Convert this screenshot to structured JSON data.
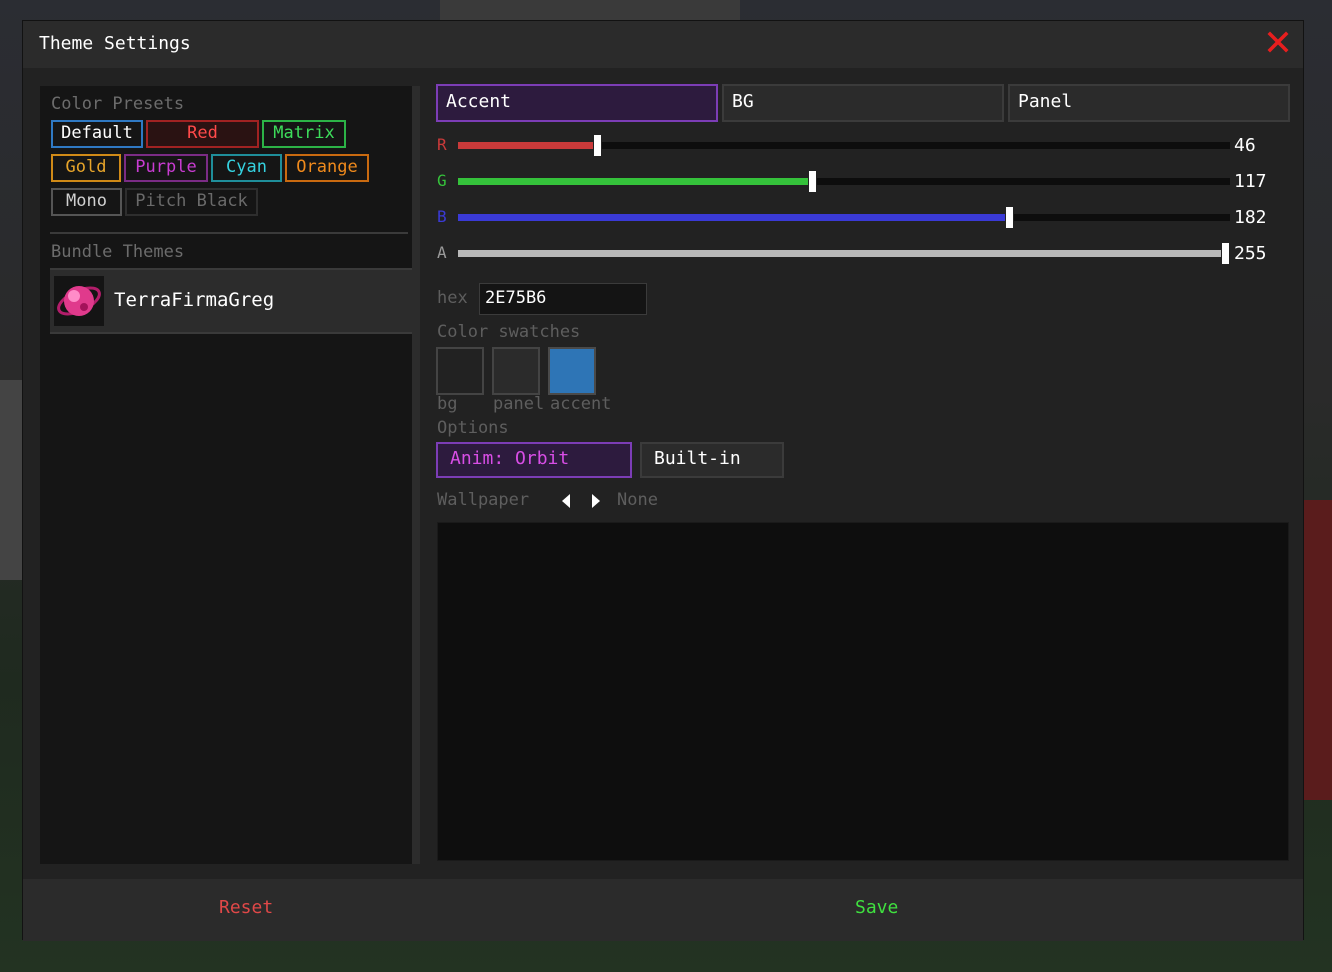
{
  "window": {
    "title": "Theme Settings"
  },
  "presets": {
    "section_label": "Color Presets",
    "items": [
      {
        "label": "Default",
        "text_color": "#ffffff",
        "border_color": "#2f79c3"
      },
      {
        "label": "Red",
        "text_color": "#ff4a4a",
        "border_color": "#a12222"
      },
      {
        "label": "Matrix",
        "text_color": "#3ddc5b",
        "border_color": "#2cb347"
      },
      {
        "label": "Gold",
        "text_color": "#e8a52a",
        "border_color": "#d08a17"
      },
      {
        "label": "Purple",
        "text_color": "#c93cd2",
        "border_color": "#7b2c85"
      },
      {
        "label": "Cyan",
        "text_color": "#35d2e0",
        "border_color": "#1f8e9a"
      },
      {
        "label": "Orange",
        "text_color": "#f08a1c",
        "border_color": "#c96a10"
      },
      {
        "label": "Mono",
        "text_color": "#d0d0d0",
        "border_color": "#555555"
      },
      {
        "label": "Pitch Black",
        "text_color": "#6a6a6a",
        "border_color": "#2e2e2e"
      }
    ]
  },
  "bundle": {
    "section_label": "Bundle Themes",
    "items": [
      {
        "name": "TerraFirmaGreg",
        "icon": "pink-planet-icon"
      }
    ]
  },
  "tabs": [
    {
      "label": "Accent",
      "active": true
    },
    {
      "label": "BG",
      "active": false
    },
    {
      "label": "Panel",
      "active": false
    }
  ],
  "sliders": [
    {
      "label": "R",
      "value": "46",
      "fraction": 0.18,
      "color": "#c93a3a"
    },
    {
      "label": "G",
      "value": "117",
      "fraction": 0.459,
      "color": "#35c23b"
    },
    {
      "label": "B",
      "value": "182",
      "fraction": 0.714,
      "color": "#3a3ad6"
    },
    {
      "label": "A",
      "value": "255",
      "fraction": 1.0,
      "color": "#b9b9b9"
    }
  ],
  "hex": {
    "label": "hex",
    "value": "2E75B6"
  },
  "swatches": {
    "section_label": "Color swatches",
    "items": [
      {
        "label": "bg",
        "color": "#222222"
      },
      {
        "label": "panel",
        "color": "#2b2b2b"
      },
      {
        "label": "accent",
        "color": "#2e75b6"
      }
    ]
  },
  "options": {
    "section_label": "Options",
    "anim_label": "Anim: Orbit",
    "builtin_label": "Built-in"
  },
  "wallpaper": {
    "label": "Wallpaper",
    "value": "None"
  },
  "footer": {
    "reset_label": "Reset",
    "save_label": "Save",
    "reset_color": "#e04848",
    "save_color": "#3fe03f"
  },
  "colors": {
    "accent": "#7c3db6",
    "close": "#e81e1e"
  }
}
